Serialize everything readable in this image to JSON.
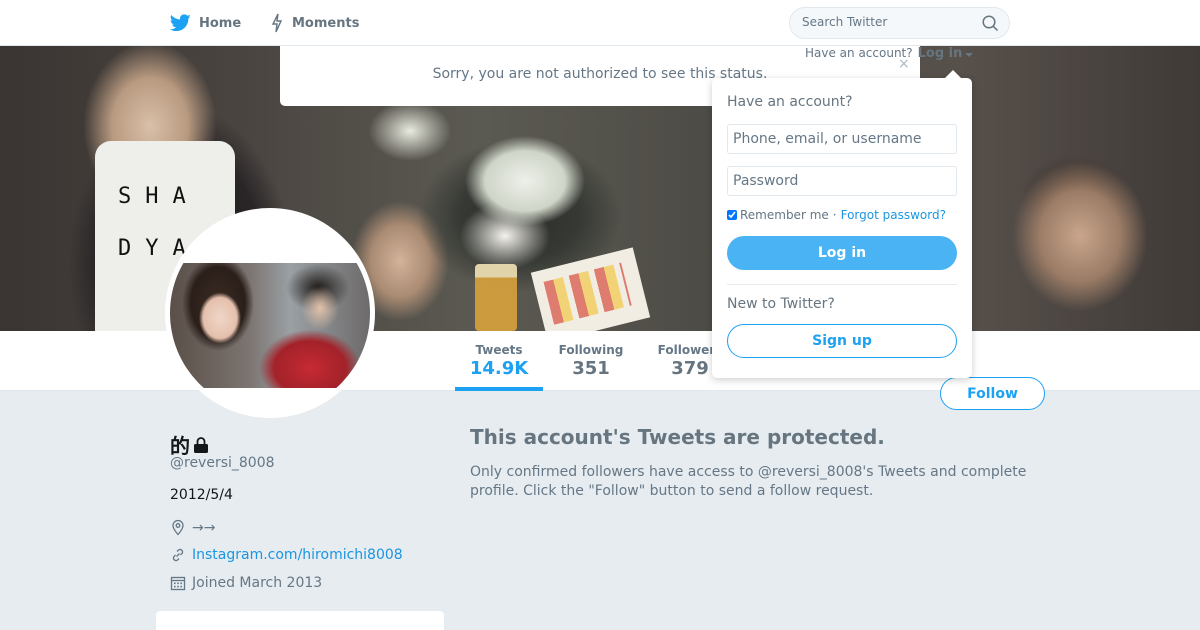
{
  "nav": {
    "home_label": "Home",
    "moments_label": "Moments",
    "search_placeholder": "Search Twitter"
  },
  "account_bar": {
    "prompt": "Have an account?",
    "login_label": "Log in"
  },
  "status_banner": {
    "message": "Sorry, you are not authorized to see this status.",
    "close": "×"
  },
  "cover": {
    "shirt_text": "SHA DYA"
  },
  "stats": {
    "tweets_label": "Tweets",
    "tweets_value": "14.9K",
    "following_label": "Following",
    "following_value": "351",
    "followers_label": "Followers",
    "followers_value": "379"
  },
  "follow_button": "Follow",
  "profile": {
    "name": "的",
    "handle": "@reversi_8008",
    "bio": "2012/5/4",
    "location": "→→",
    "url": "Instagram.com/hiromichi8008",
    "joined": "Joined March 2013"
  },
  "protected": {
    "title": "This account's Tweets are protected.",
    "description": "Only confirmed followers have access to @reversi_8008's Tweets and complete profile. Click the \"Follow\" button to send a follow request."
  },
  "login_dropdown": {
    "heading": "Have an account?",
    "username_placeholder": "Phone, email, or username",
    "password_placeholder": "Password",
    "remember_label": "Remember me",
    "separator": "·",
    "forgot_label": "Forgot password?",
    "login_button": "Log in",
    "new_prompt": "New to Twitter?",
    "signup_button": "Sign up"
  },
  "colors": {
    "accent": "#1da1f2",
    "link": "#1b95e0",
    "page_bg": "#e6ecf0"
  }
}
